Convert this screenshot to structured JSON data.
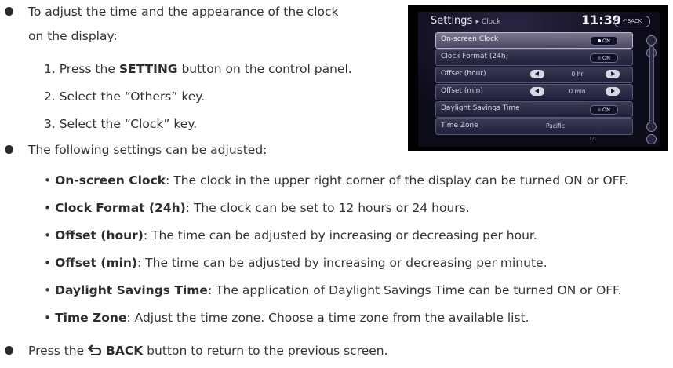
{
  "intro": {
    "text_line1": "To adjust the time and the appearance of the clock",
    "text_line2": "on the display:"
  },
  "steps": [
    {
      "prefix": "1. Press the ",
      "bold": "SETTING",
      "suffix": " button on the control panel."
    },
    {
      "text": "2. Select the “Others” key."
    },
    {
      "text": "3. Select the “Clock” key."
    }
  ],
  "settings_intro": "The following settings can be adjusted:",
  "settings": [
    {
      "name": "On-screen Clock",
      "desc": ": The clock in the upper right corner of the display can be turned ON or OFF."
    },
    {
      "name": "Clock Format (24h)",
      "desc": ": The clock can be set to 12 hours or 24 hours."
    },
    {
      "name": "Offset (hour)",
      "desc": ": The time can be adjusted by increasing or decreasing per hour."
    },
    {
      "name": "Offset (min)",
      "desc": ": The time can be adjusted by increasing or decreasing per minute."
    },
    {
      "name": "Daylight Savings Time",
      "desc": ": The application of Daylight Savings Time can be turned ON or OFF."
    },
    {
      "name": "Time Zone",
      "desc": ": Adjust the time zone. Choose a time zone from the available list."
    }
  ],
  "back": {
    "prefix": "Press the ",
    "icon": "back-arrow-icon",
    "bold": "BACK",
    "suffix": " button to return to the previous screen."
  },
  "display": {
    "title": "Settings",
    "crumb": "▸ Clock",
    "time": "11:39",
    "back_label": "BACK",
    "rows": [
      {
        "label": "On-screen Clock",
        "value": "ON"
      },
      {
        "label": "Clock Format (24h)",
        "value": "ON"
      },
      {
        "label": "Offset (hour)",
        "value": "0 hr"
      },
      {
        "label": "Offset (min)",
        "value": "0 min"
      },
      {
        "label": "Daylight Savings Time",
        "value": "ON"
      },
      {
        "label": "Time Zone",
        "value": "Pacific"
      }
    ],
    "page": "1/1"
  }
}
